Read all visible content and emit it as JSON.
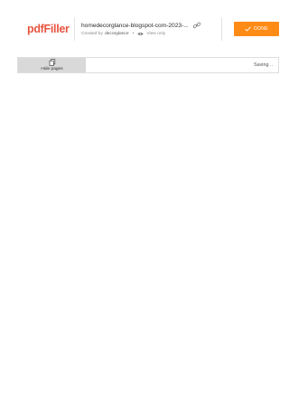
{
  "header": {
    "logo_text_pdf": "pdf",
    "logo_text_filler": "Filler",
    "doc_title": "homedecorglance-blogspot-com-2023-...",
    "created_by_label": "Created by",
    "owner": "decorglance",
    "separator": "•",
    "access_mode": "View only",
    "done_label": "DONE",
    "icons": {
      "link": "link-icon",
      "eye": "eye-icon",
      "check": "check-icon"
    },
    "colors": {
      "brand": "#e8543f",
      "done_button": "#ff8b17"
    }
  },
  "toolbar": {
    "hide_pages_label": "Hide pages",
    "hide_pages_icon": "pages-icon",
    "status": "Saving ..",
    "hide_pages_bg": "#d9d9d9"
  }
}
